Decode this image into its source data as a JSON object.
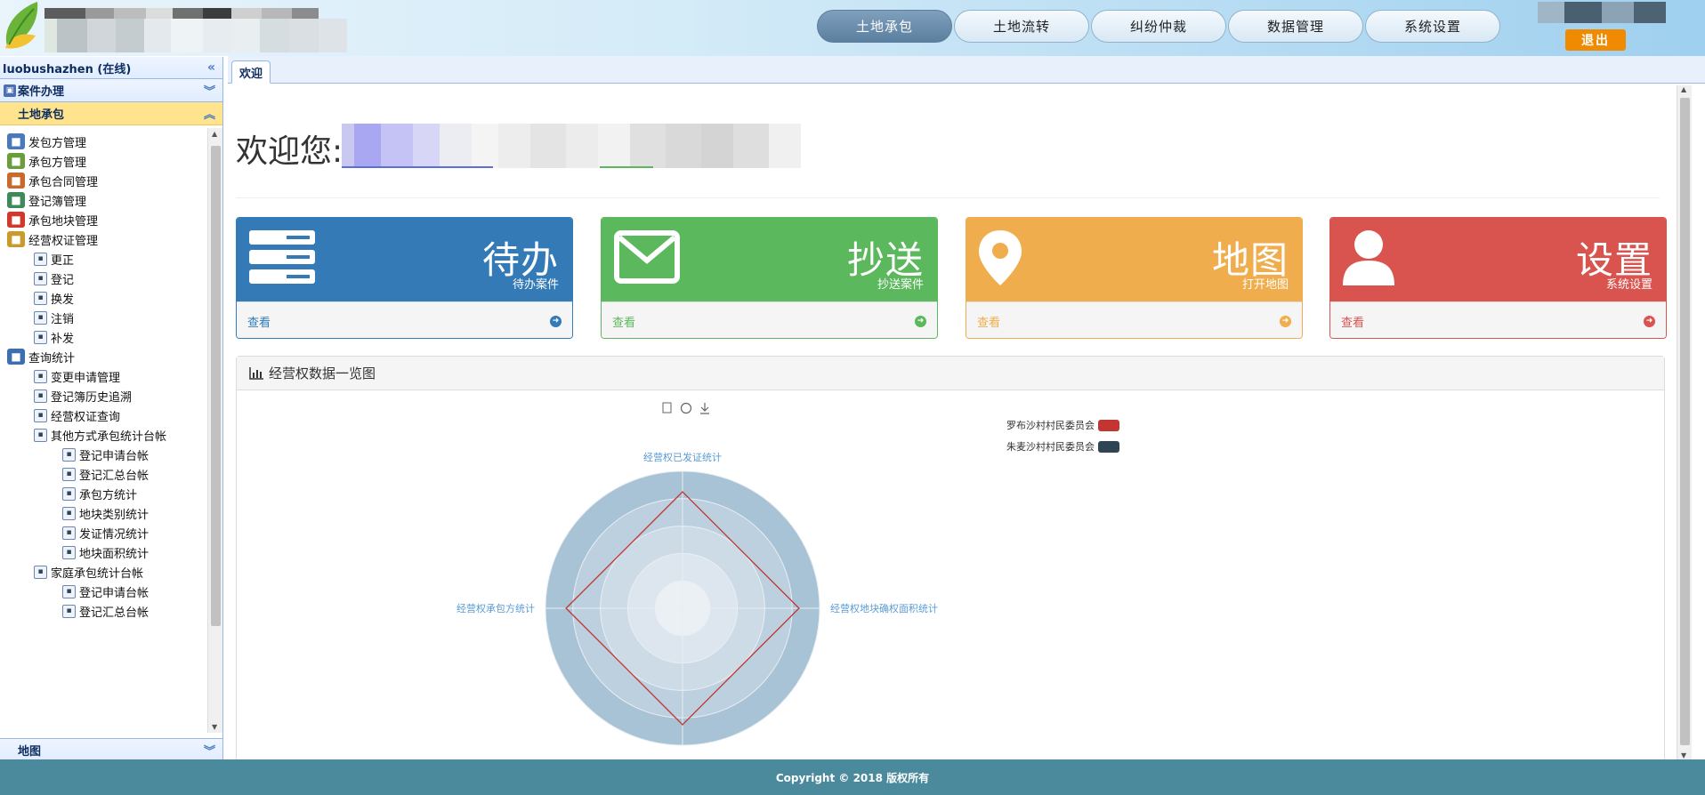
{
  "header": {
    "nav": [
      "土地承包",
      "土地流转",
      "纠纷仲裁",
      "数据管理",
      "系统设置"
    ],
    "active_nav": 0,
    "logout_label": "退出"
  },
  "sidebar": {
    "user_status": "luobushazhen (在线)",
    "section_title": "案件办理",
    "selected_group": "土地承包",
    "bottom_group": "地图",
    "tree": [
      {
        "label": "发包方管理",
        "level": 0,
        "icon": "building-icon"
      },
      {
        "label": "承包方管理",
        "level": 0,
        "icon": "users-icon"
      },
      {
        "label": "承包合同管理",
        "level": 0,
        "icon": "contract-icon"
      },
      {
        "label": "登记簿管理",
        "level": 0,
        "icon": "register-book-icon"
      },
      {
        "label": "承包地块管理",
        "level": 0,
        "icon": "land-parcel-icon"
      },
      {
        "label": "经营权证管理",
        "level": 0,
        "icon": "certificate-icon"
      },
      {
        "label": "更正",
        "level": 1,
        "icon": "edit-icon"
      },
      {
        "label": "登记",
        "level": 1,
        "icon": "register-icon"
      },
      {
        "label": "换发",
        "level": 1,
        "icon": "reissue-icon"
      },
      {
        "label": "注销",
        "level": 1,
        "icon": "cancel-icon"
      },
      {
        "label": "补发",
        "level": 1,
        "icon": "document-icon"
      },
      {
        "label": "查询统计",
        "level": 0,
        "icon": "search-icon"
      },
      {
        "label": "变更申请管理",
        "level": 1,
        "icon": "change-request-icon"
      },
      {
        "label": "登记簿历史追溯",
        "level": 1,
        "icon": "history-icon"
      },
      {
        "label": "经营权证查询",
        "level": 1,
        "icon": "query-icon"
      },
      {
        "label": "其他方式承包统计台帐",
        "level": 1,
        "icon": "ledger-icon"
      },
      {
        "label": "登记申请台帐",
        "level": 2,
        "icon": "application-ledger-icon"
      },
      {
        "label": "登记汇总台帐",
        "level": 2,
        "icon": "summary-ledger-icon"
      },
      {
        "label": "承包方统计",
        "level": 2,
        "icon": "contractor-stat-icon"
      },
      {
        "label": "地块类别统计",
        "level": 2,
        "icon": "pie-chart-icon"
      },
      {
        "label": "发证情况统计",
        "level": 2,
        "icon": "issuance-stat-icon"
      },
      {
        "label": "地块面积统计",
        "level": 2,
        "icon": "line-chart-icon"
      },
      {
        "label": "家庭承包统计台帐",
        "level": 1,
        "icon": "family-ledger-icon"
      },
      {
        "label": "登记申请台帐",
        "level": 2,
        "icon": "application-ledger-icon"
      },
      {
        "label": "登记汇总台帐",
        "level": 2,
        "icon": "summary-ledger-icon"
      }
    ]
  },
  "main": {
    "tab_label": "欢迎",
    "welcome_text": "欢迎您:",
    "cards": [
      {
        "title": "待办",
        "subtitle": "待办案件",
        "link": "查看",
        "color": "#337ab7",
        "icon": "server-list-icon"
      },
      {
        "title": "抄送",
        "subtitle": "抄送案件",
        "link": "查看",
        "color": "#5cb85c",
        "icon": "envelope-icon"
      },
      {
        "title": "地图",
        "subtitle": "打开地图",
        "link": "查看",
        "color": "#f0ad4e",
        "icon": "map-pin-icon"
      },
      {
        "title": "设置",
        "subtitle": "系统设置",
        "link": "查看",
        "color": "#d9534f",
        "icon": "user-icon"
      }
    ],
    "panel_title": "经营权数据一览图"
  },
  "chart_data": {
    "type": "radar",
    "indicators": [
      "经营权已发证统计",
      "经营权地块确权面积统计",
      "经营权承包方统计"
    ],
    "series": [
      {
        "name": "罗布沙村村民委员会",
        "color": "#c23531",
        "values": [
          0.85,
          0.85,
          0.85,
          0.85
        ]
      },
      {
        "name": "朱麦沙村村民委员会",
        "color": "#2f4554",
        "values": [
          0,
          0,
          0,
          0
        ]
      }
    ],
    "legend_position": "top-right",
    "toolbox": [
      "data-view-icon",
      "restore-icon",
      "save-image-icon"
    ]
  },
  "footer": {
    "copyright": "Copyright © 2018 版权所有"
  }
}
